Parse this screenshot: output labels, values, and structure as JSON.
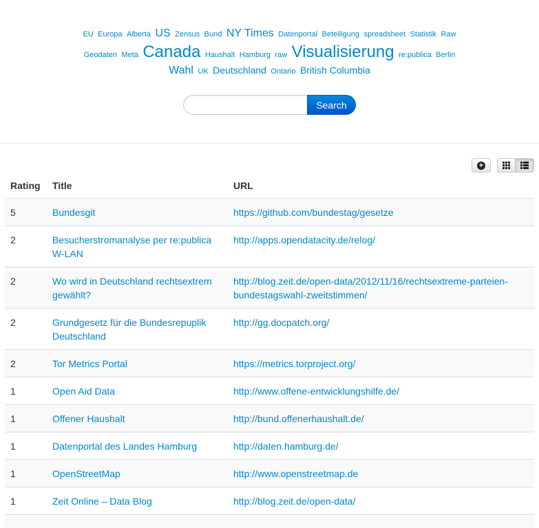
{
  "tag_cloud": [
    {
      "label": "EU",
      "size": "s1"
    },
    {
      "label": "Europa",
      "size": "s1"
    },
    {
      "label": "Alberta",
      "size": "s1"
    },
    {
      "label": "US",
      "size": "s3"
    },
    {
      "label": "Zensus",
      "size": "s1"
    },
    {
      "label": "Bund",
      "size": "s1"
    },
    {
      "label": "NY Times",
      "size": "s3"
    },
    {
      "label": "Datenportal",
      "size": "s1"
    },
    {
      "label": "Beteiligung",
      "size": "s1"
    },
    {
      "label": "spreadsheet",
      "size": "s1"
    },
    {
      "label": "Statistik",
      "size": "s1"
    },
    {
      "label": "Raw",
      "size": "s1"
    },
    {
      "label": "Geodaten",
      "size": "s1"
    },
    {
      "label": "Meta",
      "size": "s1"
    },
    {
      "label": "Canada",
      "size": "s4"
    },
    {
      "label": "Haushalt",
      "size": "s1"
    },
    {
      "label": "Hamburg",
      "size": "s1"
    },
    {
      "label": "raw",
      "size": "s1"
    },
    {
      "label": "Visualisierung",
      "size": "s4"
    },
    {
      "label": "re:publica",
      "size": "s1"
    },
    {
      "label": "Berlin",
      "size": "s1"
    },
    {
      "label": "Wahl",
      "size": "s3"
    },
    {
      "label": "UK",
      "size": "s1"
    },
    {
      "label": "Deutschland",
      "size": "s2"
    },
    {
      "label": "Ontario",
      "size": "s1"
    },
    {
      "label": "British Columbia",
      "size": "s2"
    }
  ],
  "search": {
    "placeholder": "",
    "button_label": "Search"
  },
  "table": {
    "headers": {
      "rating": "Rating",
      "title": "Title",
      "url": "URL"
    },
    "rows": [
      {
        "rating": "5",
        "title": "Bundesgit",
        "url": "https://github.com/bundestag/gesetze"
      },
      {
        "rating": "2",
        "title": "Besucherstromanalyse per re:publica W-LAN",
        "url": "http://apps.opendatacity.de/relog/"
      },
      {
        "rating": "2",
        "title": "Wo wird in Deutschland rechtsextrem gewählt?",
        "url": "http://blog.zeit.de/open-data/2012/11/16/rechtsextreme-parteien-bundestagswahl-zweitstimmen/"
      },
      {
        "rating": "2",
        "title": "Grundgesetz für die Bundesrepuplik Deutschland",
        "url": "http://gg.docpatch.org/"
      },
      {
        "rating": "2",
        "title": "Tor Metrics Portal",
        "url": "https://metrics.torproject.org/"
      },
      {
        "rating": "1",
        "title": "Open Aid Data",
        "url": "http://www.offene-entwicklungshilfe.de/"
      },
      {
        "rating": "1",
        "title": "Offener Haushalt",
        "url": "http://bund.offenerhaushalt.de/"
      },
      {
        "rating": "1",
        "title": "Datenportal des Landes Hamburg",
        "url": "http://daten.hamburg.de/"
      },
      {
        "rating": "1",
        "title": "OpenStreetMap",
        "url": "http://www.openstreetmap.de"
      },
      {
        "rating": "1",
        "title": "Zeit Online – Data Blog",
        "url": "http://blog.zeit.de/open-data/"
      },
      {
        "rating": "",
        "title": "",
        "url": ""
      }
    ]
  },
  "icons": {
    "add": "plus-circle-icon",
    "grid": "grid-view-icon",
    "list": "list-view-icon"
  }
}
